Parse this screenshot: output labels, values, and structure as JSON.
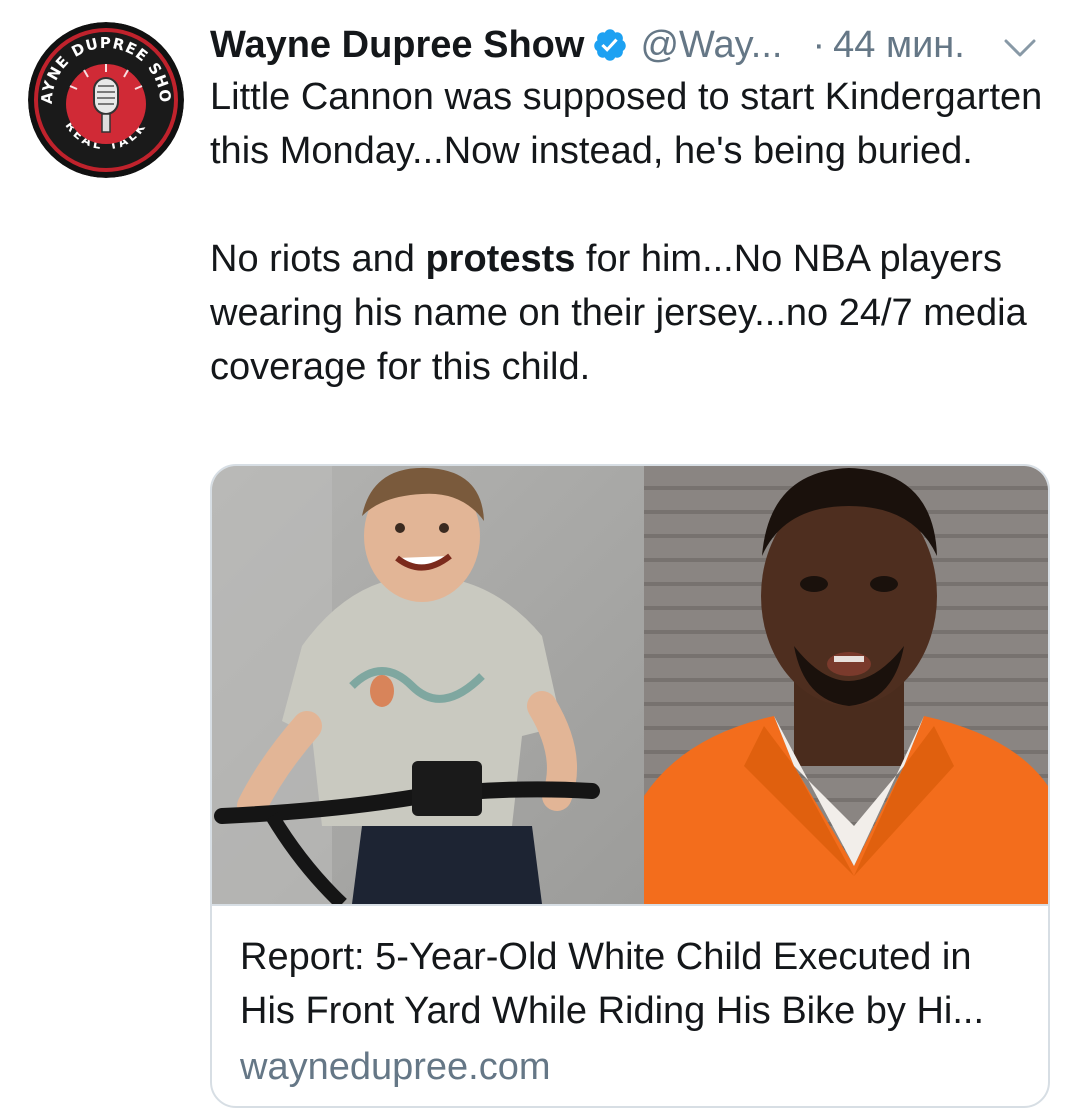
{
  "author": {
    "display_name": "Wayne Dupree Show",
    "handle": "@Way...",
    "separator": "·",
    "timestamp": "44 мин.",
    "avatar_icon": "wayne-dupree-show-logo",
    "avatar_text": {
      "top": "WAYNE DUPREE SHOW",
      "bottom": "REAL TALK"
    },
    "verified_icon": "verified-badge-icon",
    "verified_color": "#1da1f2"
  },
  "tweet": {
    "paragraph1": "Little Cannon was supposed to start Kindergarten this Monday...Now instead, he's being buried.",
    "paragraph2_part1": "No riots and ",
    "paragraph2_bold": "protests",
    "paragraph2_part2": " for him...No NBA players wearing his name on their jersey...no 24/7 media coverage for this child."
  },
  "card": {
    "image_left_icon": "child-on-bike-photo",
    "image_right_icon": "mugshot-photo",
    "title_line1": "Report: 5-Year-Old White Child Executed in",
    "title_line2": "His Front Yard While Riding His Bike by Hi...",
    "domain": "wayneduprее.com"
  },
  "colors": {
    "text": "#14171a",
    "secondary": "#657786",
    "border": "#d7dee4",
    "accent": "#1da1f2"
  }
}
